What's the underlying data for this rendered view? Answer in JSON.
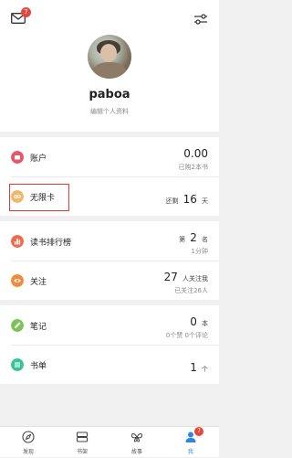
{
  "header": {
    "mail_badge": "7"
  },
  "profile": {
    "username": "paboa",
    "edit_label": "编辑个人资料"
  },
  "account": {
    "label": "账户",
    "value": "0.00",
    "sub": "已购2本书"
  },
  "unlimited": {
    "label": "无限卡",
    "prefix": "还剩",
    "value": "16",
    "unit": "天"
  },
  "ranking": {
    "label": "读书排行榜",
    "prefix": "第",
    "value": "2",
    "unit": "名",
    "sub": "1分钟"
  },
  "follow": {
    "label": "关注",
    "value": "27",
    "unit": "人关注我",
    "sub": "已关注26人"
  },
  "notes": {
    "label": "笔记",
    "value": "0",
    "unit": "本",
    "sub": "0个赞 0个评论"
  },
  "booklist": {
    "label": "书单",
    "value": "1",
    "unit": "个"
  },
  "tabs": [
    {
      "label": "发现"
    },
    {
      "label": "书架"
    },
    {
      "label": "故事"
    },
    {
      "label": "我",
      "badge": "7"
    }
  ],
  "colors": {
    "account": "#e8556a",
    "unlimited": "#f0b86a",
    "ranking": "#ee6a4e",
    "follow": "#f08a3c",
    "notes": "#7cc35a",
    "booklist": "#36c39a",
    "active_tab": "#2f86e0"
  }
}
